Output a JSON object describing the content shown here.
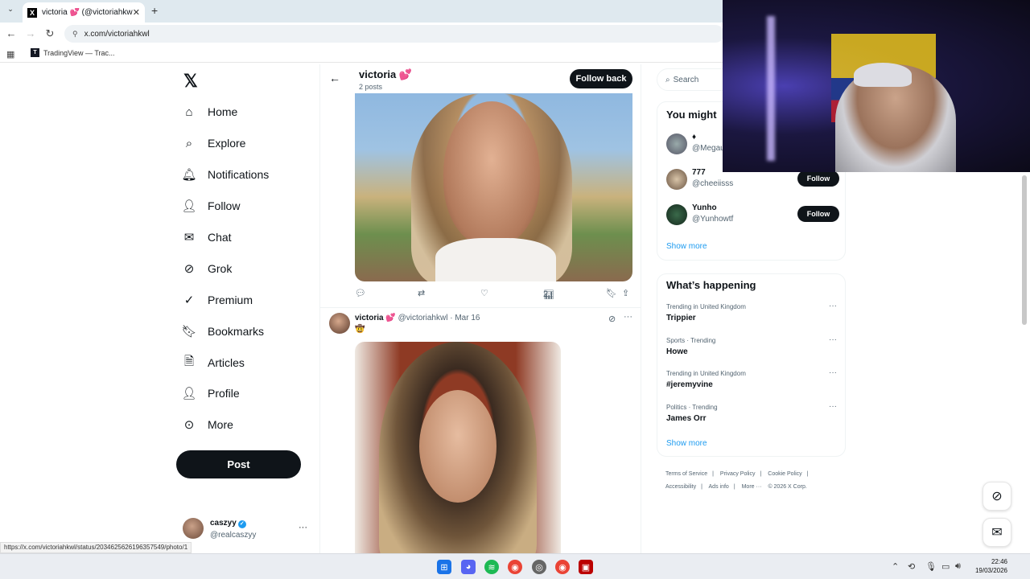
{
  "browser": {
    "tab_title": "victoria 💕 (@victoriahkwl) / X",
    "url": "x.com/victoriahkwl",
    "bookmark": "TradingView — Trac...",
    "status_url": "https://x.com/victoriahkwl/status/2034625626196357549/photo/1"
  },
  "nav": {
    "items": [
      {
        "label": "Home",
        "icon": "home-icon"
      },
      {
        "label": "Explore",
        "icon": "search-icon"
      },
      {
        "label": "Notifications",
        "icon": "bell-icon"
      },
      {
        "label": "Follow",
        "icon": "person-add-icon"
      },
      {
        "label": "Chat",
        "icon": "mail-icon"
      },
      {
        "label": "Grok",
        "icon": "grok-icon"
      },
      {
        "label": "Premium",
        "icon": "verified-icon"
      },
      {
        "label": "Bookmarks",
        "icon": "bookmark-icon"
      },
      {
        "label": "Articles",
        "icon": "article-icon"
      },
      {
        "label": "Profile",
        "icon": "person-icon"
      },
      {
        "label": "More",
        "icon": "more-icon"
      }
    ],
    "post_label": "Post"
  },
  "account": {
    "name": "caszyy",
    "handle": "@realcaszyy"
  },
  "profile": {
    "name": "victoria 💕",
    "posts": "2 posts",
    "follow_back": "Follow back"
  },
  "post1": {
    "views": "2"
  },
  "post2": {
    "name": "victoria 💕",
    "handle": "@victoriahkwl",
    "date": "· Mar 16",
    "text": "🤠"
  },
  "sidebar": {
    "search_placeholder": "Search",
    "wtf_title": "You might",
    "suggestions": [
      {
        "name": "♦",
        "handle": "@Megau"
      },
      {
        "name": "777",
        "handle": "@cheeiisss",
        "button": "Follow"
      },
      {
        "name": "Yunho",
        "handle": "@Yunhowtf",
        "button": "Follow"
      }
    ],
    "show_more": "Show more",
    "happening_title": "What’s happening",
    "trends": [
      {
        "context": "Trending in United Kingdom",
        "title": "Trippier"
      },
      {
        "context": "Sports · Trending",
        "title": "Howe"
      },
      {
        "context": "Trending in United Kingdom",
        "title": "#jeremyvine"
      },
      {
        "context": "Politics · Trending",
        "title": "James Orr"
      }
    ],
    "show_more_2": "Show more",
    "footer": [
      "Terms of Service",
      "|",
      "Privacy Policy",
      "|",
      "Cookie Policy",
      "|",
      "Accessibility",
      "|",
      "Ads info",
      "|",
      "More ···",
      "© 2026 X Corp."
    ]
  },
  "clock": {
    "time": "22:46",
    "date": "19/03/2026"
  }
}
